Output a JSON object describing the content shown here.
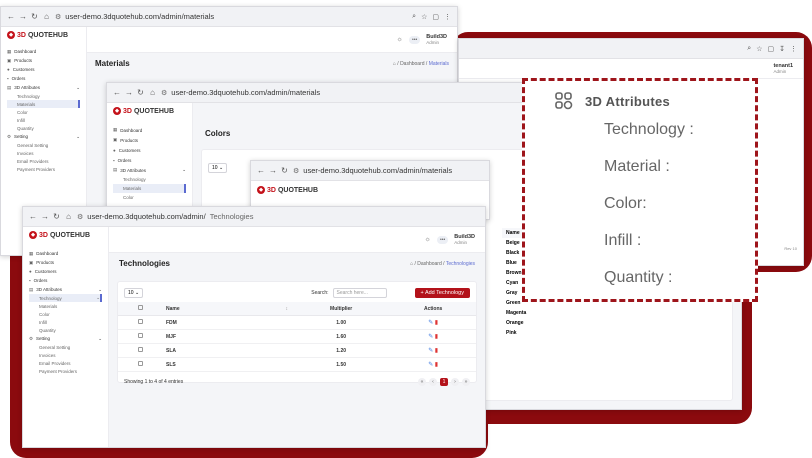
{
  "browser": {
    "url_full": "user-demo.3dquotehub.com/admin/materials",
    "url_front_truncated": "user-demo.3dquotehub.com/admin/",
    "url_front_suffix": "Technologies"
  },
  "brand": {
    "prefix": "3D",
    "name": "QUOTEHUB"
  },
  "user": {
    "name": "Build3D",
    "role": "Admin",
    "alt_name": "tenant1"
  },
  "sidebar": {
    "items": [
      {
        "label": "Dashboard",
        "icon": "grid-icon"
      },
      {
        "label": "Products",
        "icon": "cube-icon"
      },
      {
        "label": "Customers",
        "icon": "users-icon"
      },
      {
        "label": "Orders",
        "icon": "cart-icon"
      },
      {
        "label": "3D Attributes",
        "icon": "attributes-icon"
      }
    ],
    "attributes_sub": [
      "Technology",
      "Materials",
      "Color",
      "Infill",
      "Quantity"
    ],
    "setting": "Setting",
    "setting_sub": [
      "General Setting",
      "Invoices",
      "Email Providers",
      "Payment Providers"
    ]
  },
  "pages": {
    "materials": {
      "title": "Materials",
      "crumb_home": "Dashboard",
      "crumb_current": "Materials"
    },
    "colors": {
      "title": "Colors",
      "page_size": "10"
    },
    "technologies": {
      "title": "Technologies",
      "crumb_home": "Dashboard",
      "crumb_current": "Technologies",
      "page_size": "10",
      "search_label": "Search:",
      "search_placeholder": "Search here...",
      "add_button": "+ Add Technology",
      "columns": [
        "Name",
        "Multiplier",
        "Actions"
      ],
      "rows": [
        {
          "name": "FDM",
          "multiplier": "1.00"
        },
        {
          "name": "MJF",
          "multiplier": "1.60"
        },
        {
          "name": "SLA",
          "multiplier": "1.20"
        },
        {
          "name": "SLS",
          "multiplier": "1.50"
        }
      ],
      "footer": "Showing 1 to 4 of 4 entries",
      "current_page": "1"
    }
  },
  "colors_table": {
    "column": "Name",
    "rows": [
      "Beige",
      "Black",
      "Blue",
      "Brown",
      "Cyan",
      "Gray",
      "Green",
      "Magenta",
      "Orange",
      "Pink"
    ]
  },
  "attributes_panel": {
    "title": "3D Attributes",
    "items": [
      "Technology :",
      "Material :",
      "Color:",
      "Infill :",
      "Quantity :"
    ]
  },
  "misc": {
    "rev_label": "Rev 10"
  },
  "colors": {
    "accent_red": "#8b0a0e",
    "button_red": "#b3121a",
    "link_blue": "#5b6ad0"
  }
}
